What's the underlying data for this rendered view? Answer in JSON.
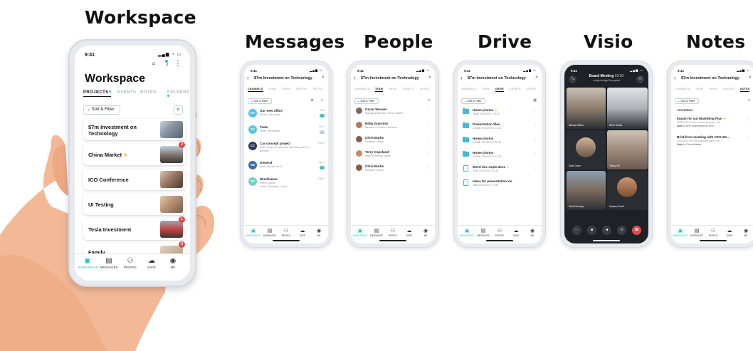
{
  "section_titles": {
    "workspace": "Workspace",
    "messages": "Messages",
    "people": "People",
    "drive": "Drive",
    "visio": "Visio",
    "notes": "Notes"
  },
  "colors": {
    "accent": "#30c2b5",
    "badge": "#e5484d",
    "star": "#f2c230",
    "folder": "#43b9d6"
  },
  "workspace_phone": {
    "time": "9:41",
    "title": "Workspace",
    "tabs": [
      "PROJECTS",
      "EVENTS",
      "NOTES",
      "FOLDERS"
    ],
    "sort_label": "Sort & Filter",
    "projects": [
      {
        "name": "$7m Investment on Technology",
        "badge": ""
      },
      {
        "name": "China Market",
        "badge": "2"
      },
      {
        "name": "ICO Conference",
        "badge": ""
      },
      {
        "name": "UI Testing",
        "badge": ""
      },
      {
        "name": "Tesla Investment",
        "badge": "1"
      },
      {
        "name": "Family",
        "badge": "3"
      }
    ],
    "nav": [
      "WORKSPACE",
      "MESSAGES",
      "PEOPLE",
      "SAFE",
      "ME"
    ]
  },
  "common": {
    "time": "9:41",
    "title": "$7m Investment on Technology",
    "sort_label": "Sort & Filter",
    "tabs": [
      "CHANNELS",
      "TEAM",
      "DRIVE",
      "EVENTS",
      "NOTES"
    ],
    "nav": [
      "WORKSPACE",
      "MESSAGES",
      "PEOPLE",
      "SAFE",
      "ME"
    ]
  },
  "messages": [
    {
      "initials": "OF",
      "title": "Our new office",
      "sub": "Public: Yes please",
      "meta": "Now",
      "count": "1",
      "color": "#4fc3e8"
    },
    {
      "initials": "TE",
      "title": "Team",
      "sub": "Team: Yes please",
      "meta": "09:30",
      "count": "200",
      "color": "#5ec3d6"
    },
    {
      "initials": "CC",
      "title": "Car concept project",
      "sub": "Jolie: Check the last mail that Daisy sent to account",
      "meta": "Sep 2",
      "count": "",
      "color": "#2e3a56"
    },
    {
      "initials": "GE",
      "title": "General",
      "sub": "Ilona: Ok, lets do it!",
      "meta": "Sep 1",
      "count": "4",
      "color": "#3b6ea6"
    },
    {
      "initials": "WI",
      "title": "Wireframes",
      "sub": "Invest Capital\nOscar: Shocking, I know",
      "meta": "Sep 2",
      "count": "",
      "color": "#6fd0c9"
    }
  ],
  "people": [
    {
      "name": "Oscar Weaver",
      "role": "Managing Director, Invest Capital"
    },
    {
      "name": "Hilda Guerrero",
      "role": "Director of Product, Amazon"
    },
    {
      "name": "Chris Burke",
      "role": "Designer, Mingo"
    },
    {
      "name": "Terry Copeland",
      "role": "Head of Design, Apple"
    },
    {
      "name": "Chris Burke",
      "role": "Designer, Mingo"
    }
  ],
  "drive": [
    {
      "type": "folder",
      "name": "Home photos",
      "meta": "18MB 12/03/2017 13:24",
      "star": true
    },
    {
      "type": "folder",
      "name": "Presentation files",
      "meta": "120MB 12/03/2017 11:24",
      "star": false
    },
    {
      "type": "folder",
      "name": "Home photos",
      "meta": "170MB 12/03/2017 16:34",
      "star": false
    },
    {
      "type": "folder",
      "name": "Home photos",
      "meta": "120MB 12/03/2017 13:34",
      "star": false
    },
    {
      "type": "doc",
      "name": "Word doc exple.docx",
      "meta": "1MB 12/03/2017 13:34",
      "star": true
    },
    {
      "type": "doc",
      "name": "Ideas for presentation.xls",
      "meta": "2MB 12/03/2017 11:56",
      "star": false
    }
  ],
  "visio": {
    "title": "Board Meeting",
    "duration": "03:50",
    "subtitle": "App-to-App Encrypted",
    "participants": [
      "Michael Wilson",
      "Steve Davila",
      "Sean Corne",
      "Tiffany Hill",
      "Clark Kennedy",
      "Sydney Orwell"
    ]
  },
  "notes": {
    "section": "YESTERDAY",
    "items": [
      {
        "title": "Inputs for our Marketing Plan",
        "sub": "12/03/2017 In the current process, the...",
        "note": "In $7m Investment on Tech",
        "star": true
      },
      {
        "title": "Brief from meeting with CEO We...",
        "sub": "12/03/2017 All the collected data is im...",
        "note": "In China Market",
        "star": false
      }
    ]
  }
}
